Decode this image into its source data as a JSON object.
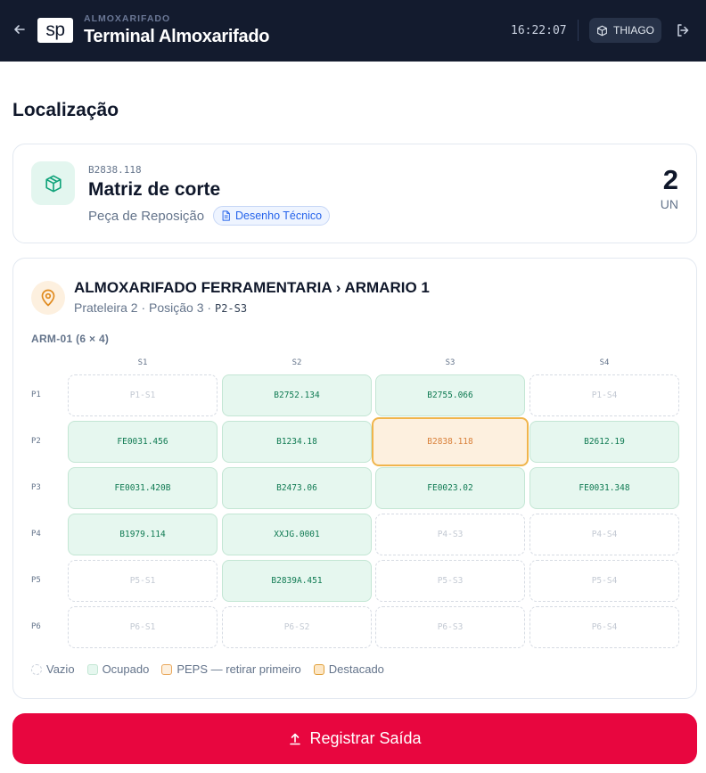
{
  "header": {
    "logo_text": "sp",
    "eyebrow": "ALMOXARIFADO",
    "title": "Terminal Almoxarifado",
    "clock": "16:22:07",
    "user": "THIAGO"
  },
  "page": {
    "section_title": "Localização"
  },
  "product": {
    "code": "B2838.118",
    "name": "Matriz de corte",
    "type": "Peça de Reposição",
    "doc_badge": "Desenho Técnico",
    "quantity": "2",
    "unit": "UN"
  },
  "location": {
    "path": "ALMOXARIFADO FERRAMENTARIA › ARMARIO 1",
    "detail": "Prateleira 2 · Posição 3 ·",
    "detail_code": "P2-S3",
    "cabinet_label": "ARM-01 (6 × 4)",
    "columns": [
      "S1",
      "S2",
      "S3",
      "S4"
    ],
    "rows": [
      {
        "label": "P1",
        "cells": [
          {
            "text": "P1-S1",
            "state": "empty"
          },
          {
            "text": "B2752.134",
            "state": "occupied"
          },
          {
            "text": "B2755.066",
            "state": "occupied"
          },
          {
            "text": "P1-S4",
            "state": "empty"
          }
        ]
      },
      {
        "label": "P2",
        "cells": [
          {
            "text": "FE0031.456",
            "state": "occupied"
          },
          {
            "text": "B1234.18",
            "state": "occupied"
          },
          {
            "text": "B2838.118",
            "state": "highlight"
          },
          {
            "text": "B2612.19",
            "state": "occupied"
          }
        ]
      },
      {
        "label": "P3",
        "cells": [
          {
            "text": "FE0031.420B",
            "state": "occupied"
          },
          {
            "text": "B2473.06",
            "state": "occupied"
          },
          {
            "text": "FE0023.02",
            "state": "occupied"
          },
          {
            "text": "FE0031.348",
            "state": "occupied"
          }
        ]
      },
      {
        "label": "P4",
        "cells": [
          {
            "text": "B1979.114",
            "state": "occupied"
          },
          {
            "text": "XXJG.0001",
            "state": "occupied"
          },
          {
            "text": "P4-S3",
            "state": "empty"
          },
          {
            "text": "P4-S4",
            "state": "empty"
          }
        ]
      },
      {
        "label": "P5",
        "cells": [
          {
            "text": "P5-S1",
            "state": "empty"
          },
          {
            "text": "B2839A.451",
            "state": "occupied"
          },
          {
            "text": "P5-S3",
            "state": "empty"
          },
          {
            "text": "P5-S4",
            "state": "empty"
          }
        ]
      },
      {
        "label": "P6",
        "cells": [
          {
            "text": "P6-S1",
            "state": "empty"
          },
          {
            "text": "P6-S2",
            "state": "empty"
          },
          {
            "text": "P6-S3",
            "state": "empty"
          },
          {
            "text": "P6-S4",
            "state": "empty"
          }
        ]
      }
    ],
    "legend": [
      {
        "key": "empty",
        "label": "Vazio"
      },
      {
        "key": "occupied",
        "label": "Ocupado"
      },
      {
        "key": "peps",
        "label": "PEPS — retirar primeiro"
      },
      {
        "key": "highlight",
        "label": "Destacado"
      }
    ]
  },
  "action": {
    "label": "Registrar Saída"
  },
  "colors": {
    "header_bg": "#131b2e",
    "accent_red": "#e8063f",
    "occupied_green": "#0f7a52",
    "highlight_orange": "#f0b54c",
    "doc_blue": "#2563eb"
  }
}
